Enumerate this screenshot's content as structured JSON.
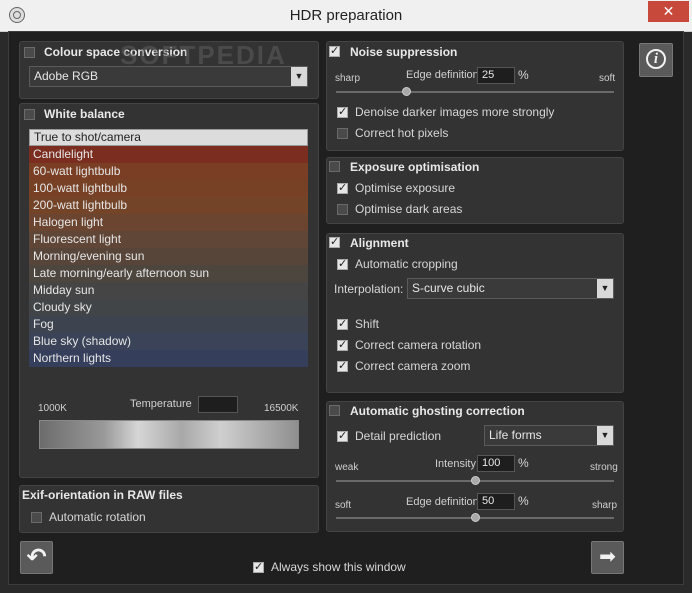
{
  "window": {
    "title": "HDR preparation",
    "close_glyph": "✕",
    "app_icon": "aperture-icon"
  },
  "colour_space": {
    "label": "Colour space conversion",
    "checked": false,
    "selected": "Adobe RGB"
  },
  "white_balance": {
    "label": "White balance",
    "checked": false,
    "items": [
      {
        "label": "True to shot/camera",
        "color": "#dcdcdc"
      },
      {
        "label": "Candlelight",
        "color": "#7b2e20"
      },
      {
        "label": "60-watt lightbulb",
        "color": "#7a3e24"
      },
      {
        "label": "100-watt lightbulb",
        "color": "#774125"
      },
      {
        "label": "200-watt lightbulb",
        "color": "#744428"
      },
      {
        "label": "Halogen light",
        "color": "#6b4530"
      },
      {
        "label": "Fluorescent light",
        "color": "#604637"
      },
      {
        "label": "Morning/evening sun",
        "color": "#574539"
      },
      {
        "label": "Late morning/early afternoon sun",
        "color": "#4d463f"
      },
      {
        "label": "Midday sun",
        "color": "#464545"
      },
      {
        "label": "Cloudy sky",
        "color": "#424548"
      },
      {
        "label": "Fog",
        "color": "#3d4450"
      },
      {
        "label": "Blue sky (shadow)",
        "color": "#3a4357"
      },
      {
        "label": "Northern lights",
        "color": "#353f5c"
      }
    ],
    "selected_index": 0,
    "temperature": {
      "label": "Temperature",
      "min_label": "1000K",
      "max_label": "16500K",
      "value": ""
    }
  },
  "exif": {
    "label": "Exif-orientation in RAW files",
    "auto_rotation": {
      "label": "Automatic rotation",
      "checked": false
    }
  },
  "noise": {
    "label": "Noise suppression",
    "checked": true,
    "sharp_label": "sharp",
    "soft_label": "soft",
    "edge_label": "Edge definition",
    "edge_value": "25",
    "edge_unit": "%",
    "edge_fraction": 0.25,
    "denoise_darker": {
      "label": "Denoise darker images more strongly",
      "checked": true
    },
    "hot_pixels": {
      "label": "Correct hot pixels",
      "checked": false
    }
  },
  "exposure": {
    "label": "Exposure optimisation",
    "checked": false,
    "optimise_exposure": {
      "label": "Optimise exposure",
      "checked": true
    },
    "optimise_dark": {
      "label": "Optimise dark areas",
      "checked": false
    }
  },
  "alignment": {
    "label": "Alignment",
    "checked": true,
    "auto_crop": {
      "label": "Automatic cropping",
      "checked": true
    },
    "interpolation_label": "Interpolation:",
    "interpolation_value": "S-curve cubic",
    "shift": {
      "label": "Shift",
      "checked": true
    },
    "rotation": {
      "label": "Correct camera rotation",
      "checked": true
    },
    "zoom": {
      "label": "Correct camera zoom",
      "checked": true
    }
  },
  "ghosting": {
    "label": "Automatic ghosting correction",
    "checked": false,
    "detail": {
      "label": "Detail prediction",
      "checked": true
    },
    "detail_value": "Life forms",
    "weak_label": "weak",
    "strong_label": "strong",
    "intensity_label": "Intensity",
    "intensity_value": "100",
    "intensity_unit": "%",
    "intensity_fraction": 0.5,
    "soft_label": "soft",
    "sharp_label": "sharp",
    "edge_label": "Edge definition",
    "edge_value": "50",
    "edge_unit": "%",
    "edge_fraction": 0.5
  },
  "footer": {
    "always_show": {
      "label": "Always show this window",
      "checked": true
    }
  },
  "buttons": {
    "info_glyph": "i",
    "back_glyph": "↶",
    "next_glyph": "➡"
  },
  "watermark": "SOFTPEDIA"
}
